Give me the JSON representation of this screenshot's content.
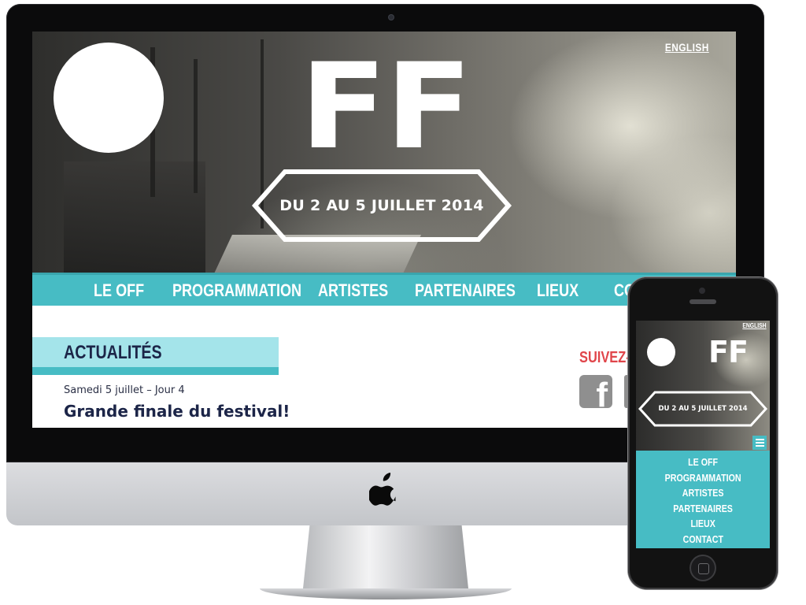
{
  "desktop": {
    "language_link": "ENGLISH",
    "logo_text": "FF",
    "date_badge": "DU 2 AU 5 JUILLET 2014",
    "nav": [
      {
        "label": "LE OFF"
      },
      {
        "label": "PROGRAMMATION"
      },
      {
        "label": "ARTISTES"
      },
      {
        "label": "PARTENAIRES"
      },
      {
        "label": "LIEUX"
      },
      {
        "label": "CO"
      }
    ],
    "news": {
      "heading": "ACTUALITÉS",
      "post_meta": "Samedi 5 juillet – Jour 4",
      "post_title": "Grande finale du festival!"
    },
    "social": {
      "follow_label": "SUIVEZ-N",
      "facebook_glyph": "f"
    }
  },
  "mobile": {
    "language_link": "ENGLISH",
    "logo_text": "FF",
    "date_badge": "DU 2 AU 5 JUILLET 2014",
    "nav": [
      {
        "label": "LE OFF"
      },
      {
        "label": "PROGRAMMATION"
      },
      {
        "label": "ARTISTES"
      },
      {
        "label": "PARTENAIRES"
      },
      {
        "label": "LIEUX"
      },
      {
        "label": "CONTACT"
      }
    ]
  },
  "colors": {
    "accent_teal": "#47bcc4",
    "light_teal": "#a4e4ea",
    "navy_text": "#1c2548",
    "follow_red": "#e0454a",
    "icon_grey": "#8f8f8f"
  },
  "icons": [
    "apple-logo-icon",
    "facebook-icon",
    "hamburger-menu-icon",
    "home-button-icon"
  ]
}
